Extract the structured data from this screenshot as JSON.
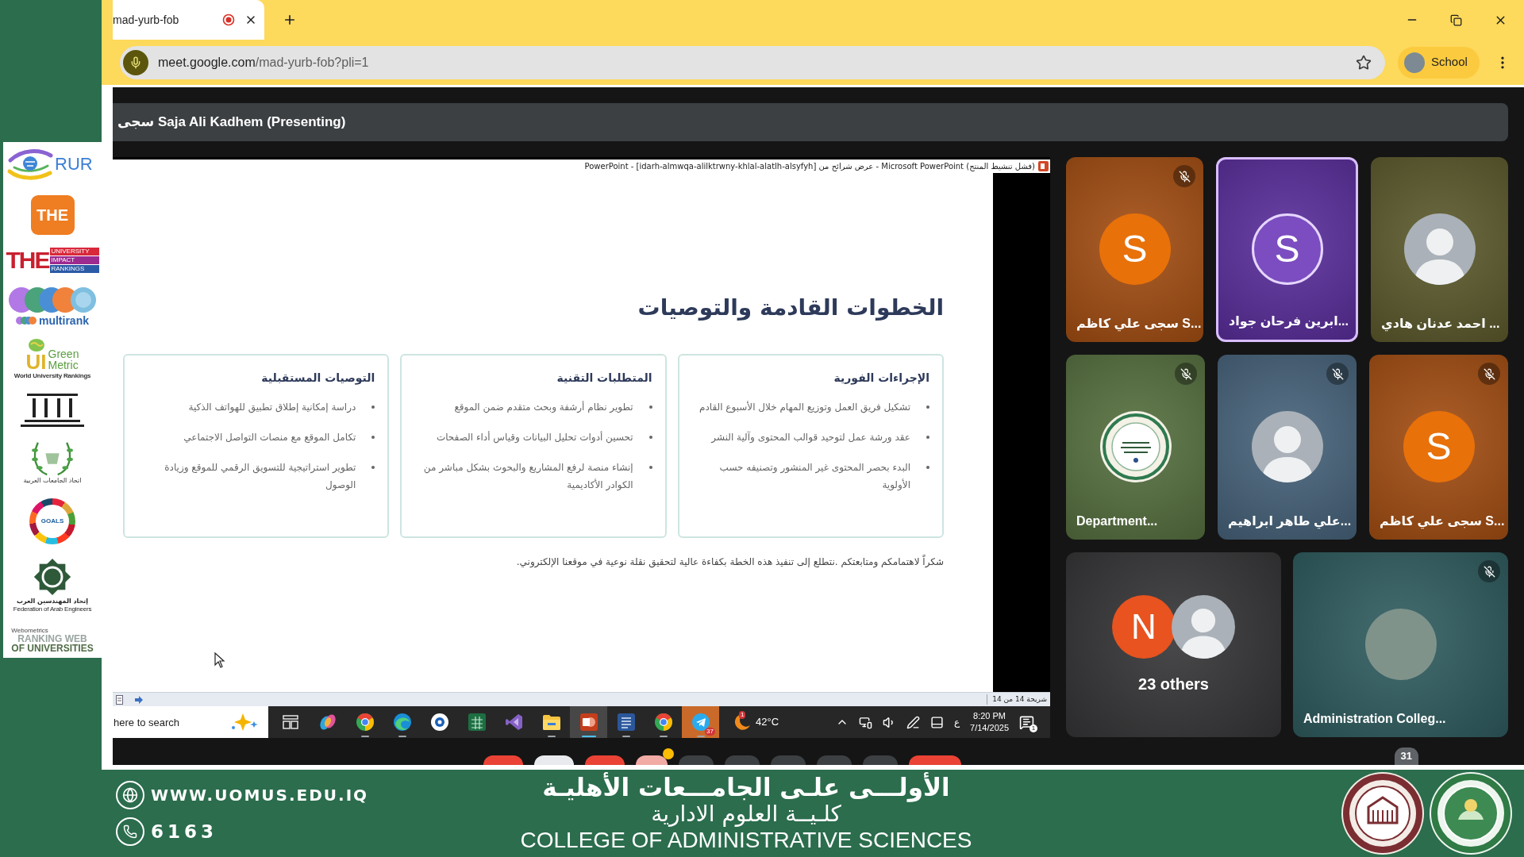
{
  "browser": {
    "tab": {
      "title": "mad-yurb-fob",
      "recording": true
    },
    "address": {
      "host": "meet.google.com",
      "path": "/mad-yurb-fob?pli=1"
    },
    "profile": {
      "label": "School"
    }
  },
  "logos": [
    {
      "kind": "rur",
      "text": "RUR"
    },
    {
      "kind": "tile",
      "text": "THE"
    },
    {
      "kind": "impact",
      "text": "THE",
      "lines": [
        "UNIVERSITY",
        "IMPACT",
        "RANKINGS"
      ]
    },
    {
      "kind": "multirank",
      "text": "multirank"
    },
    {
      "kind": "greenmetric",
      "text": "UI",
      "lines": [
        "Green",
        "Metric"
      ],
      "caption": "World University Rankings"
    },
    {
      "kind": "building"
    },
    {
      "kind": "wreath",
      "caption": "اتحاد الجامعات العربية"
    },
    {
      "kind": "wheel",
      "text": "GOALS"
    },
    {
      "kind": "emblem",
      "caption": "إتحاد المهندسين العرب",
      "subcaption": "Federation of Arab Engineers"
    },
    {
      "kind": "webometrics",
      "text": "Webometrics",
      "lines": [
        "RANKING WEB",
        "OF UNIVERSITIES"
      ]
    }
  ],
  "meet": {
    "presenter": "سجى Saja Ali Kadhem (Presenting)",
    "screen": {
      "window_title": "PowerPoint - [idarh-almwqa-alilktrwny-khlal-alatlh-alsyfyh] عرض شرائح من - Microsoft PowerPoint (فشل تنشيط المنتج)",
      "slide": {
        "title": "الخطوات القادمة والتوصيات",
        "cards": [
          {
            "heading": "الإجراءات الفورية",
            "bullets": [
              "تشكيل فريق العمل وتوزيع المهام خلال الأسبوع القادم",
              "عقد ورشة عمل لتوحيد قوالب المحتوى وآلية النشر",
              "البدء بحصر المحتوى غير المنشور وتصنيفه حسب الأولوية"
            ]
          },
          {
            "heading": "المتطلبات التقنية",
            "bullets": [
              "تطوير نظام أرشفة وبحث متقدم ضمن الموقع",
              "تحسين أدوات تحليل البيانات وقياس أداء الصفحات",
              "إنشاء منصة لرفع المشاريع والبحوث بشكل مباشر من الكوادر الأكاديمية"
            ]
          },
          {
            "heading": "التوصيات المستقبلية",
            "bullets": [
              "دراسة إمكانية إطلاق تطبيق للهواتف الذكية",
              "تكامل الموقع مع منصات التواصل الاجتماعي",
              "تطوير استراتيجية للتسويق الرقمي للموقع وزيادة الوصول"
            ]
          }
        ],
        "footer": "شكراً لاهتمامكم ومتابعتكم .نتطلع إلى تنفيذ هذه الخطة بكفاءة عالية لتحقيق نقلة نوعية في موقعنا الإلكتروني."
      },
      "status": "شريحة 14 من 14",
      "taskbar": {
        "search": {
          "placeholder": "here to search"
        },
        "apps": [
          {
            "kind": "task-view",
            "running": false,
            "active": false,
            "flashing": false
          },
          {
            "kind": "copilot",
            "running": false,
            "active": false,
            "flashing": false
          },
          {
            "kind": "chrome",
            "running": true,
            "active": false,
            "flashing": false
          },
          {
            "kind": "edge",
            "running": true,
            "active": false,
            "flashing": false
          },
          {
            "kind": "round-app",
            "running": false,
            "active": false,
            "flashing": false
          },
          {
            "kind": "excel",
            "running": false,
            "active": false,
            "flashing": false
          },
          {
            "kind": "visual-studio",
            "running": false,
            "active": false,
            "flashing": false
          },
          {
            "kind": "explorer",
            "running": true,
            "active": false,
            "flashing": false
          },
          {
            "kind": "powerpoint",
            "running": true,
            "active": true,
            "flashing": false
          },
          {
            "kind": "word",
            "running": true,
            "active": false,
            "flashing": false
          },
          {
            "kind": "chrome",
            "running": true,
            "active": false,
            "flashing": false
          },
          {
            "kind": "telegram",
            "running": true,
            "active": false,
            "flashing": true,
            "badge": "37"
          }
        ],
        "weather": {
          "badge": "1",
          "temperature": "42°C"
        },
        "language": "ع",
        "time": "8:20 PM",
        "date": "7/14/2025",
        "notifications": "1"
      }
    },
    "tiles": [
      {
        "kind": "person",
        "name": "احمد عدنان هادي ...",
        "color": "#5c5a2c",
        "avatar": {
          "kind": "photo"
        },
        "muted": false,
        "speaking": false
      },
      {
        "kind": "person",
        "name": "ابرين فرحان جواد...",
        "color": "#5a2e9c",
        "avatar": {
          "kind": "letter",
          "letter": "S",
          "color": "#7b4dc0"
        },
        "muted": false,
        "speaking": true
      },
      {
        "kind": "person",
        "name": "سجى علي كاظم S...",
        "color": "#a44e12",
        "avatar": {
          "kind": "letter",
          "letter": "S",
          "color": "#e8710a"
        },
        "muted": true,
        "speaking": false
      },
      {
        "kind": "person",
        "name": "سجى علي كاظم S...",
        "color": "#a44e12",
        "avatar": {
          "kind": "letter",
          "letter": "S",
          "color": "#e8710a"
        },
        "muted": true,
        "speaking": false
      },
      {
        "kind": "person",
        "name": "علي طاهر ابراهيم...",
        "color": "#47637b",
        "avatar": {
          "kind": "photo"
        },
        "muted": true,
        "speaking": false
      },
      {
        "kind": "person",
        "name": "Department...",
        "color": "#56703f",
        "avatar": {
          "kind": "seal"
        },
        "muted": true,
        "speaking": false
      },
      {
        "kind": "others",
        "label": "23 others",
        "color": "#353537",
        "avatars": [
          {
            "kind": "letter",
            "letter": "N",
            "color": "#e8531f"
          },
          {
            "kind": "photo"
          }
        ]
      },
      {
        "kind": "person",
        "name": "Administration Colleg...",
        "color": "#2f5c5f",
        "avatar": {
          "kind": "group-photo"
        },
        "muted": true,
        "speaking": false
      }
    ],
    "participant_count": "31",
    "controls": [
      {
        "kind": "toggle",
        "off": true,
        "selected": false,
        "indicator": false
      },
      {
        "kind": "toggle",
        "off": false,
        "selected": true,
        "indicator": false
      },
      {
        "kind": "toggle",
        "off": true,
        "selected": false,
        "indicator": false
      },
      {
        "kind": "toggle",
        "off": true,
        "selected": true,
        "indicator": true
      },
      {
        "kind": "toggle",
        "off": false,
        "selected": false,
        "indicator": false
      },
      {
        "kind": "toggle",
        "off": false,
        "selected": false,
        "indicator": false
      },
      {
        "kind": "toggle",
        "off": false,
        "selected": false,
        "indicator": false
      },
      {
        "kind": "toggle",
        "off": false,
        "selected": false,
        "indicator": false
      },
      {
        "kind": "toggle",
        "off": false,
        "selected": false,
        "indicator": false
      },
      {
        "kind": "leave",
        "indicator": false
      }
    ]
  },
  "banner": {
    "website": "WWW.UOMUS.EDU.IQ",
    "phone": "6163",
    "lines": [
      "الأولـــى علـى الجامـــعات الأهليـة",
      "كلـيــة العلوم الادارية",
      "COLLEGE OF ADMINISTRATIVE SCIENCES"
    ]
  }
}
